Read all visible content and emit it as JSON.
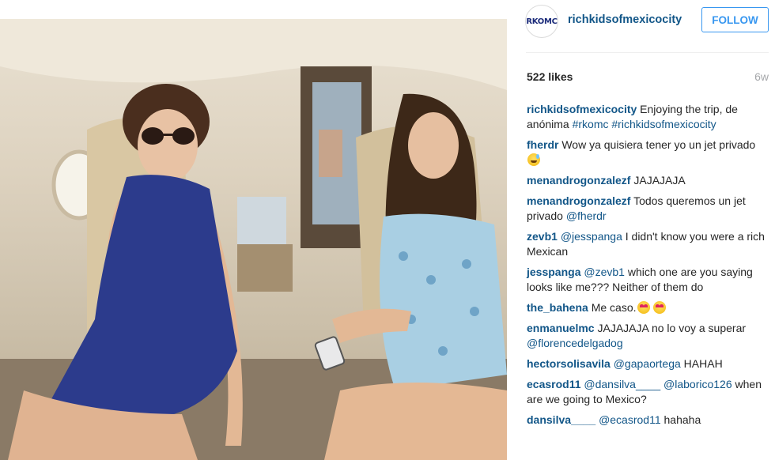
{
  "post": {
    "username": "richkidsofmexicocity",
    "avatar_text": "RKOMC",
    "follow_label": "FOLLOW",
    "likes": "522 likes",
    "time": "6w",
    "photo_alt": "Two women sitting in a private jet cabin"
  },
  "comments": [
    {
      "user": "richkidsofmexicocity",
      "parts": [
        {
          "t": "text",
          "v": " Enjoying the trip, de anónima "
        },
        {
          "t": "tag",
          "v": "#rkomc"
        },
        {
          "t": "text",
          "v": " "
        },
        {
          "t": "tag",
          "v": "#richkidsofmexicocity"
        }
      ]
    },
    {
      "user": "fherdr",
      "parts": [
        {
          "t": "text",
          "v": " Wow ya quisiera tener yo un jet privado "
        },
        {
          "t": "emoji",
          "v": "sweat"
        }
      ]
    },
    {
      "user": "menandrogonzalezf",
      "parts": [
        {
          "t": "text",
          "v": " JAJAJAJA"
        }
      ]
    },
    {
      "user": "menandrogonzalezf",
      "parts": [
        {
          "t": "text",
          "v": " Todos queremos un jet privado "
        },
        {
          "t": "tag",
          "v": "@fherdr"
        }
      ]
    },
    {
      "user": "zevb1",
      "parts": [
        {
          "t": "text",
          "v": " "
        },
        {
          "t": "tag",
          "v": "@jesspanga"
        },
        {
          "t": "text",
          "v": " I didn't know you were a rich Mexican"
        }
      ]
    },
    {
      "user": "jesspanga",
      "parts": [
        {
          "t": "text",
          "v": " "
        },
        {
          "t": "tag",
          "v": "@zevb1"
        },
        {
          "t": "text",
          "v": " which one are you saying looks like me??? Neither of them do"
        }
      ]
    },
    {
      "user": "the_bahena",
      "parts": [
        {
          "t": "text",
          "v": " Me caso."
        },
        {
          "t": "emoji",
          "v": "heart-eyes"
        },
        {
          "t": "text",
          "v": " "
        },
        {
          "t": "emoji",
          "v": "heart-eyes"
        }
      ]
    },
    {
      "user": "enmanuelmc",
      "parts": [
        {
          "t": "text",
          "v": " JAJAJAJA no lo voy a superar "
        },
        {
          "t": "tag",
          "v": "@florencedelgadog"
        }
      ]
    },
    {
      "user": "hectorsolisavila",
      "parts": [
        {
          "t": "text",
          "v": " "
        },
        {
          "t": "tag",
          "v": "@gapaortega"
        },
        {
          "t": "text",
          "v": " HAHAH"
        }
      ]
    },
    {
      "user": "ecasrod11",
      "parts": [
        {
          "t": "text",
          "v": " "
        },
        {
          "t": "tag",
          "v": "@dansilva____"
        },
        {
          "t": "text",
          "v": " "
        },
        {
          "t": "tag",
          "v": "@laborico126"
        },
        {
          "t": "text",
          "v": " when are we going to Mexico?"
        }
      ]
    },
    {
      "user": "dansilva____",
      "parts": [
        {
          "t": "text",
          "v": " "
        },
        {
          "t": "tag",
          "v": "@ecasrod11"
        },
        {
          "t": "text",
          "v": " hahaha"
        }
      ]
    }
  ],
  "colors": {
    "link": "#125688",
    "follow": "#3897f0",
    "muted": "#a5a7aa",
    "text": "#262626"
  }
}
